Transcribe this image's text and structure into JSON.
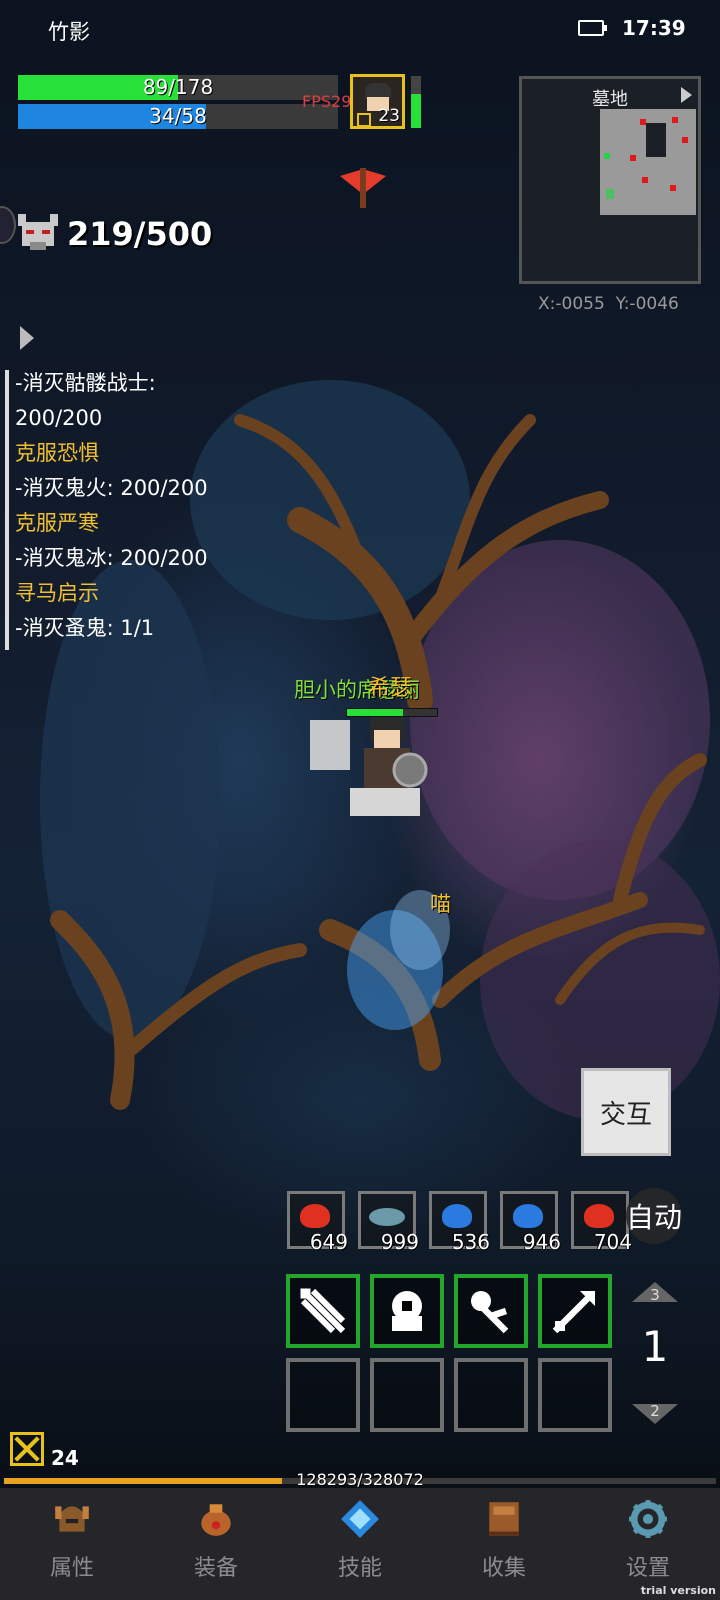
{
  "status_bar": {
    "app_name": "竹影",
    "time": "17:39",
    "battery_icon": "battery-icon"
  },
  "player": {
    "hp": {
      "current": 89,
      "max": 178,
      "label": "89/178",
      "color": "#27e03a"
    },
    "mp": {
      "current": 34,
      "max": 58,
      "label": "34/58",
      "color": "#1e86e0"
    },
    "level": "23",
    "fps": "FPS29",
    "name_tag": "胆小的席瑟丽",
    "pet_name_overlay": "希瑟"
  },
  "kill_counter": {
    "label": "219/500"
  },
  "minimap": {
    "title": "墓地",
    "coords": "X:-0055  Y:-0046"
  },
  "quests": [
    {
      "text": "-消灭骷髅战士:",
      "type": "task"
    },
    {
      "text": "200/200",
      "type": "task"
    },
    {
      "text": "克服恐惧",
      "type": "head"
    },
    {
      "text": "-消灭鬼火: 200/200",
      "type": "task"
    },
    {
      "text": "克服严寒",
      "type": "head"
    },
    {
      "text": "-消灭鬼冰: 200/200",
      "type": "task"
    },
    {
      "text": "寻马启示",
      "type": "head"
    },
    {
      "text": "-消灭蚤鬼: 1/1",
      "type": "task"
    }
  ],
  "cat_label": "喵",
  "interact_button": "交互",
  "auto_button": "自动",
  "items": [
    {
      "count": "649",
      "icon": "red-potion-icon"
    },
    {
      "count": "999",
      "icon": "fish-icon"
    },
    {
      "count": "536",
      "icon": "blue-potion-icon"
    },
    {
      "count": "946",
      "icon": "blue-potion-icon"
    },
    {
      "count": "704",
      "icon": "red-potion-icon"
    }
  ],
  "skills": [
    "arrow-volley-icon",
    "shield-bash-icon",
    "charge-icon",
    "arrow-shot-icon"
  ],
  "page_selector": {
    "up": "3",
    "current": "1",
    "down": "2"
  },
  "bottom_level": "24",
  "experience": {
    "label": "128293/328072",
    "current": 128293,
    "max": 328072
  },
  "nav": [
    {
      "label": "属性",
      "icon": "helmet-icon"
    },
    {
      "label": "装备",
      "icon": "bag-icon"
    },
    {
      "label": "技能",
      "icon": "crystal-icon"
    },
    {
      "label": "收集",
      "icon": "book-icon"
    },
    {
      "label": "设置",
      "icon": "gear-icon"
    }
  ],
  "watermark": "trial version"
}
